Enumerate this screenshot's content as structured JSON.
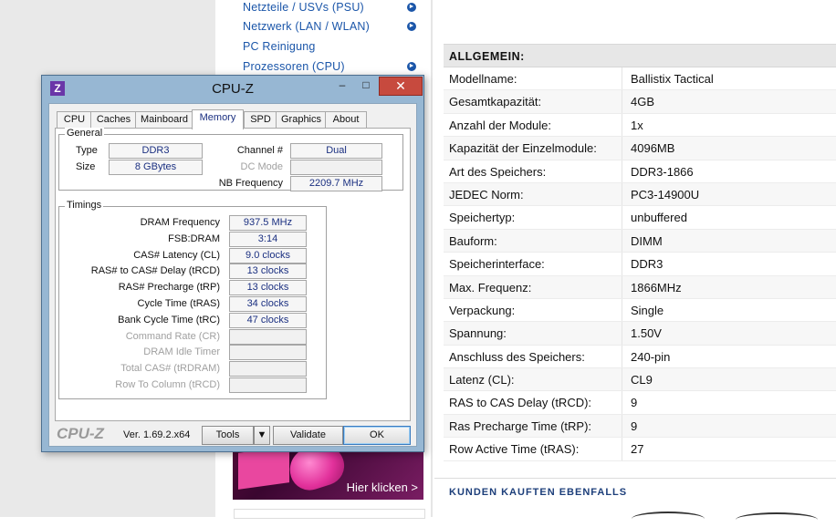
{
  "nav": {
    "items": [
      {
        "label": "Netzteile / USVs (PSU)",
        "arrow": true
      },
      {
        "label": "Netzwerk (LAN / WLAN)",
        "arrow": true
      },
      {
        "label": "PC Reinigung",
        "arrow": false
      },
      {
        "label": "Prozessoren (CPU)",
        "arrow": true
      }
    ],
    "arrow_glyph": "►"
  },
  "ad": {
    "cta": "Hier klicken >"
  },
  "specs": {
    "header": "ALLGEMEIN:",
    "rows": [
      {
        "k": "Modellname:",
        "v": "Ballistix Tactical"
      },
      {
        "k": "Gesamtkapazität:",
        "v": "4GB"
      },
      {
        "k": "Anzahl der Module:",
        "v": "1x"
      },
      {
        "k": "Kapazität der Einzelmodule:",
        "v": "4096MB"
      },
      {
        "k": "Art des Speichers:",
        "v": "DDR3-1866"
      },
      {
        "k": "JEDEC Norm:",
        "v": "PC3-14900U"
      },
      {
        "k": "Speichertyp:",
        "v": "unbuffered"
      },
      {
        "k": "Bauform:",
        "v": "DIMM"
      },
      {
        "k": "Speicherinterface:",
        "v": "DDR3"
      },
      {
        "k": "Max. Frequenz:",
        "v": "1866MHz"
      },
      {
        "k": "Verpackung:",
        "v": "Single"
      },
      {
        "k": "Spannung:",
        "v": "1.50V"
      },
      {
        "k": "Anschluss des Speichers:",
        "v": "240-pin"
      },
      {
        "k": "Latenz (CL):",
        "v": "CL9"
      },
      {
        "k": "RAS to CAS Delay (tRCD):",
        "v": "9"
      },
      {
        "k": "Ras Precharge Time (tRP):",
        "v": "9"
      },
      {
        "k": "Row Active Time (tRAS):",
        "v": "27"
      }
    ]
  },
  "bought": {
    "title": "KUNDEN KAUFTEN EBENFALLS"
  },
  "cpuz": {
    "title": "CPU-Z",
    "icon_letter": "Z",
    "controls": {
      "minimize": "–",
      "maximize": "□",
      "close": "✕"
    },
    "tabs": [
      "CPU",
      "Caches",
      "Mainboard",
      "Memory",
      "SPD",
      "Graphics",
      "About"
    ],
    "active_tab": "Memory",
    "general": {
      "title": "General",
      "type_label": "Type",
      "type_value": "DDR3",
      "size_label": "Size",
      "size_value": "8 GBytes",
      "channel_label": "Channel #",
      "channel_value": "Dual",
      "dcmode_label": "DC Mode",
      "dcmode_value": "",
      "nbfreq_label": "NB Frequency",
      "nbfreq_value": "2209.7 MHz"
    },
    "timings": {
      "title": "Timings",
      "rows": [
        {
          "label": "DRAM Frequency",
          "value": "937.5 MHz",
          "dim": false
        },
        {
          "label": "FSB:DRAM",
          "value": "3:14",
          "dim": false
        },
        {
          "label": "CAS# Latency (CL)",
          "value": "9.0 clocks",
          "dim": false
        },
        {
          "label": "RAS# to CAS# Delay (tRCD)",
          "value": "13 clocks",
          "dim": false
        },
        {
          "label": "RAS# Precharge (tRP)",
          "value": "13 clocks",
          "dim": false
        },
        {
          "label": "Cycle Time (tRAS)",
          "value": "34 clocks",
          "dim": false
        },
        {
          "label": "Bank Cycle Time (tRC)",
          "value": "47 clocks",
          "dim": false
        },
        {
          "label": "Command Rate (CR)",
          "value": "",
          "dim": true
        },
        {
          "label": "DRAM Idle Timer",
          "value": "",
          "dim": true
        },
        {
          "label": "Total CAS# (tRDRAM)",
          "value": "",
          "dim": true
        },
        {
          "label": "Row To Column (tRCD)",
          "value": "",
          "dim": true
        }
      ]
    },
    "footer": {
      "logo": "CPU-Z",
      "version": "Ver. 1.69.2.x64",
      "tools": "Tools",
      "tools_arrow": "▼",
      "validate": "Validate",
      "ok": "OK"
    }
  }
}
